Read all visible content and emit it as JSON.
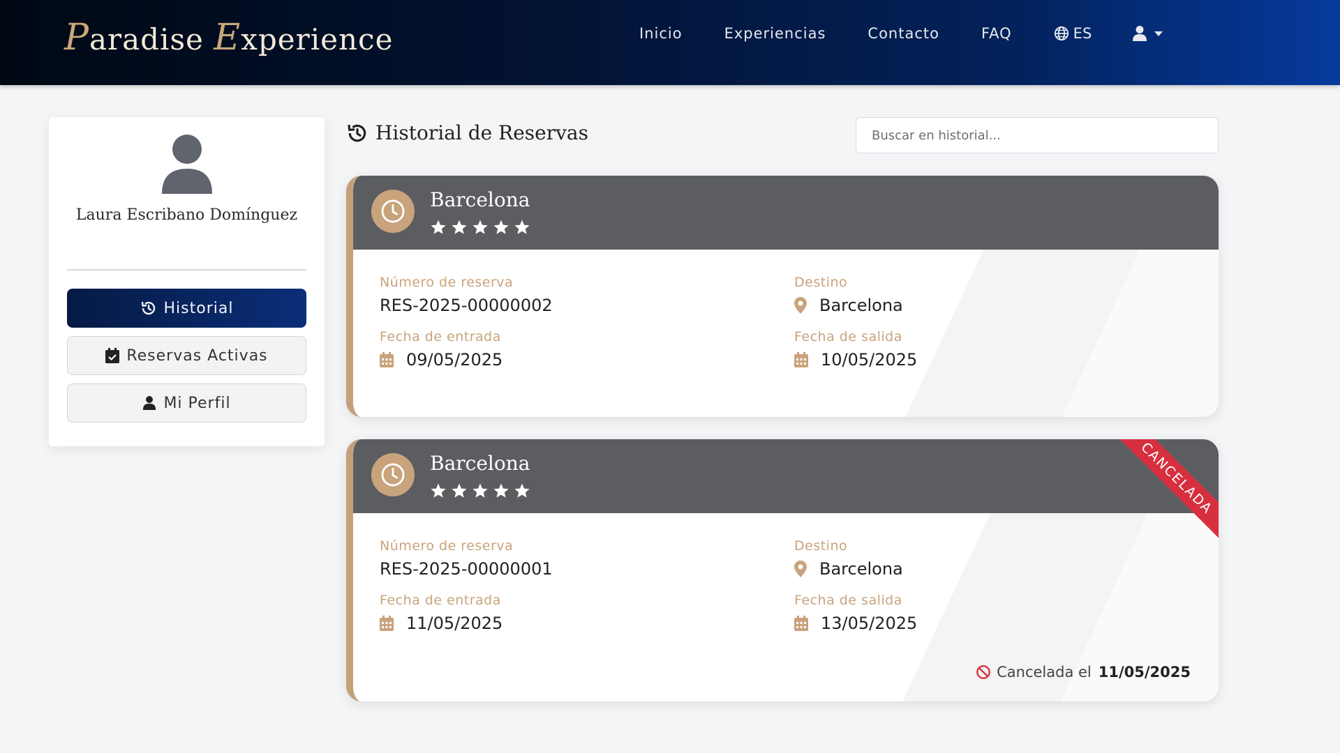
{
  "brand": {
    "cap1": "P",
    "rest1": "aradise",
    "cap2": "E",
    "rest2": "xperience"
  },
  "nav": {
    "links": [
      "Inicio",
      "Experiencias",
      "Contacto",
      "FAQ"
    ],
    "language": "ES",
    "user_icon": "user-icon"
  },
  "sidebar": {
    "user_name": "Laura Escribano Domínguez",
    "buttons": [
      {
        "label": "Historial",
        "icon": "history-icon",
        "active": true
      },
      {
        "label": "Reservas Activas",
        "icon": "calendar-check-icon",
        "active": false
      },
      {
        "label": "Mi Perfil",
        "icon": "user-icon",
        "active": false
      }
    ]
  },
  "main": {
    "title": "Historial de Reservas",
    "search_placeholder": "Buscar en historial...",
    "labels": {
      "reservation_number": "Número de reserva",
      "destination": "Destino",
      "check_in": "Fecha de entrada",
      "check_out": "Fecha de salida"
    },
    "reservations": [
      {
        "city": "Barcelona",
        "stars": 5,
        "number": "RES-2025-00000002",
        "destination": "Barcelona",
        "check_in": "09/05/2025",
        "check_out": "10/05/2025",
        "cancelled": false
      },
      {
        "city": "Barcelona",
        "stars": 5,
        "number": "RES-2025-00000001",
        "destination": "Barcelona",
        "check_in": "11/05/2025",
        "check_out": "13/05/2025",
        "cancelled": true,
        "ribbon": "CANCELADA",
        "cancel_text": "Cancelada el",
        "cancel_date": "11/05/2025"
      }
    ]
  },
  "colors": {
    "accent_gold": "#c4a07a",
    "navy": "#061a44",
    "card_header": "#5b5d61",
    "cancel_red": "#d6303f"
  }
}
